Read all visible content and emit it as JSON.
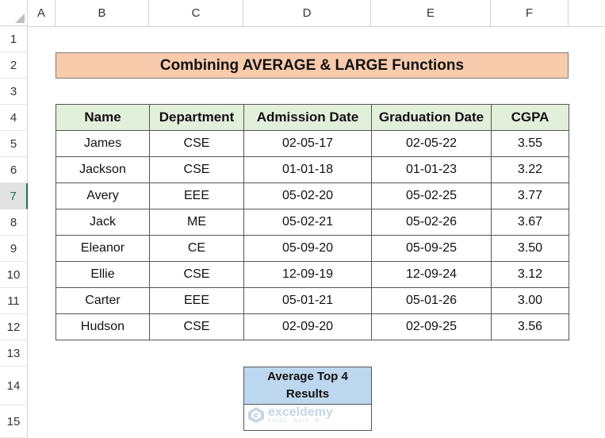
{
  "columns": [
    "A",
    "B",
    "C",
    "D",
    "E",
    "F"
  ],
  "rows": [
    "1",
    "2",
    "3",
    "4",
    "5",
    "6",
    "7",
    "8",
    "9",
    "10",
    "11",
    "12",
    "13",
    "14",
    "15"
  ],
  "selected_row": "7",
  "title": "Combining AVERAGE & LARGE Functions",
  "table": {
    "headers": [
      "Name",
      "Department",
      "Admission Date",
      "Graduation Date",
      "CGPA"
    ],
    "rows": [
      [
        "James",
        "CSE",
        "02-05-17",
        "02-05-22",
        "3.55"
      ],
      [
        "Jackson",
        "CSE",
        "01-01-18",
        "01-01-23",
        "3.22"
      ],
      [
        "Avery",
        "EEE",
        "05-02-20",
        "05-02-25",
        "3.77"
      ],
      [
        "Jack",
        "ME",
        "05-02-21",
        "05-02-26",
        "3.67"
      ],
      [
        "Eleanor",
        "CE",
        "05-09-20",
        "05-09-25",
        "3.50"
      ],
      [
        "Ellie",
        "CSE",
        "12-09-19",
        "12-09-24",
        "3.12"
      ],
      [
        "Carter",
        "EEE",
        "05-01-21",
        "05-01-26",
        "3.00"
      ],
      [
        "Hudson",
        "CSE",
        "02-09-20",
        "02-09-25",
        "3.56"
      ]
    ]
  },
  "result": {
    "label_line1": "Average Top 4",
    "label_line2": "Results",
    "value": ""
  },
  "watermark": {
    "name": "exceldemy",
    "tagline": "EXCEL · DATA · BI"
  },
  "colors": {
    "title_bg": "#f8cbad",
    "header_bg": "#e2efda",
    "result_label_bg": "#bdd7ee",
    "selection": "#217346"
  }
}
